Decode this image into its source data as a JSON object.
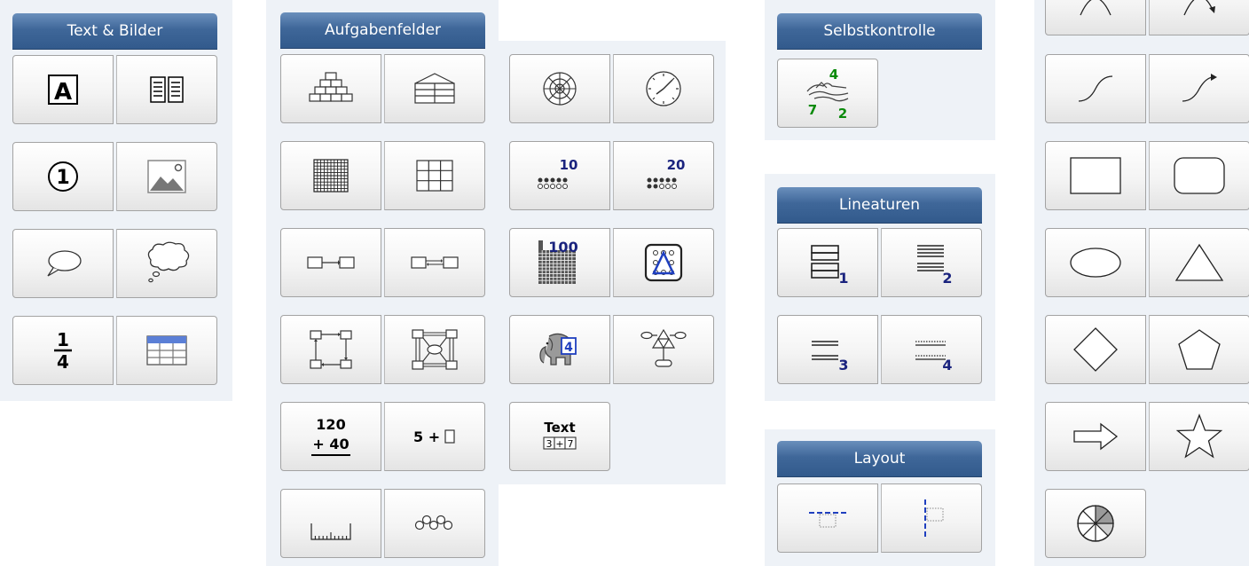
{
  "panels": {
    "text_bilder": {
      "title": "Text & Bilder"
    },
    "aufgabenfelder": {
      "title": "Aufgabenfelder"
    },
    "selbstkontrolle": {
      "title": "Selbstkontrolle"
    },
    "lineaturen": {
      "title": "Lineaturen"
    },
    "layout": {
      "title": "Layout"
    }
  },
  "icon_text": {
    "font_a": "A",
    "number_one": "1",
    "fraction_num": "1",
    "fraction_den": "4",
    "selbst_top": "4",
    "selbst_left": "7",
    "selbst_right": "2",
    "dots_10": "10",
    "dots_20": "20",
    "hundred": "100",
    "elephant_number": "4",
    "calc_top": "120",
    "calc_bottom": "+ 40",
    "equation": "5 + ",
    "text_label": "Text",
    "text_digits": [
      "3",
      "+",
      "7"
    ],
    "line_1": "1",
    "line_2": "2",
    "line_3": "3",
    "line_4": "4"
  },
  "colors": {
    "header": "#3f6799",
    "selbst_green": "#0a8a0a",
    "number_blue": "#1a237e"
  }
}
